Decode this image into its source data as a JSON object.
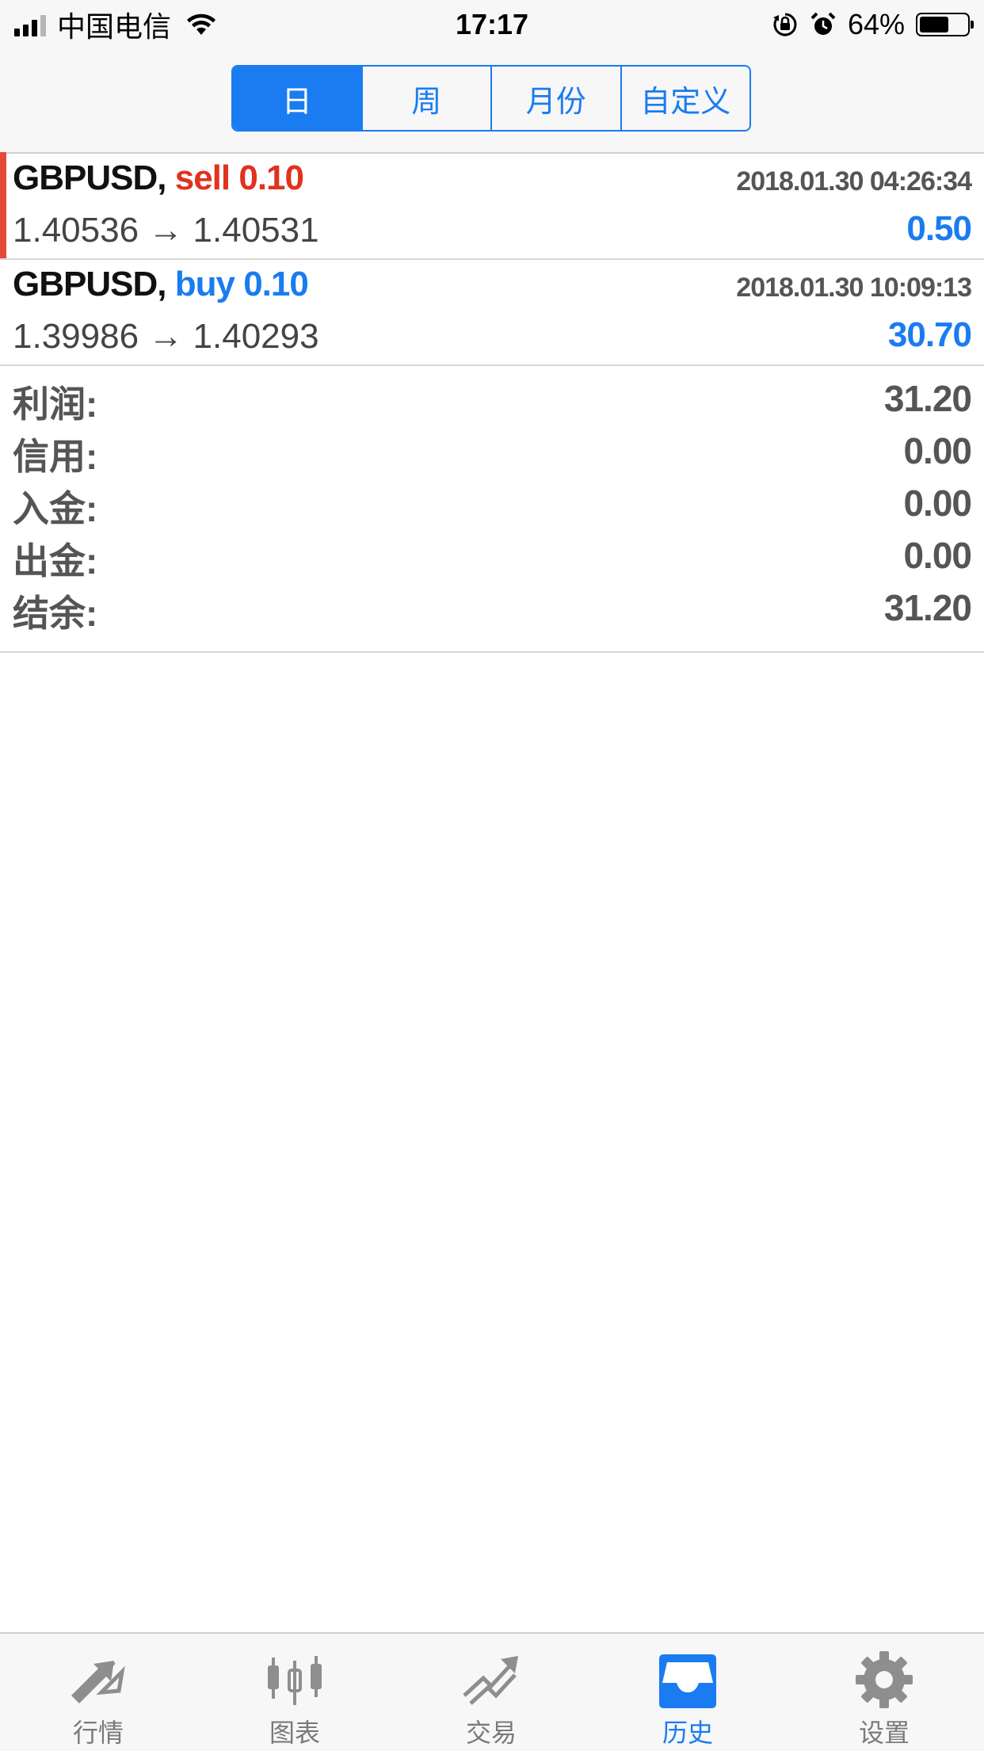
{
  "status_bar": {
    "carrier": "中国电信",
    "time": "17:17",
    "battery": "64%",
    "battery_level": 0.64
  },
  "period_tabs": [
    {
      "label": "日",
      "active": true
    },
    {
      "label": "周",
      "active": false
    },
    {
      "label": "月份",
      "active": false
    },
    {
      "label": "自定义",
      "active": false
    }
  ],
  "deals": [
    {
      "symbol": "GBPUSD,",
      "type": "sell",
      "volume": "0.10",
      "time": "2018.01.30 04:26:34",
      "open_price": "1.40536",
      "arrow": "→",
      "close_price": "1.40531",
      "profit": "0.50"
    },
    {
      "symbol": "GBPUSD,",
      "type": "buy",
      "volume": "0.10",
      "time": "2018.01.30 10:09:13",
      "open_price": "1.39986",
      "arrow": "→",
      "close_price": "1.40293",
      "profit": "30.70"
    }
  ],
  "summary": [
    {
      "label": "利润:",
      "value": "31.20"
    },
    {
      "label": "信用:",
      "value": "0.00"
    },
    {
      "label": "入金:",
      "value": "0.00"
    },
    {
      "label": "出金:",
      "value": "0.00"
    },
    {
      "label": "结余:",
      "value": "31.20"
    }
  ],
  "tab_bar": [
    {
      "label": "行情",
      "icon": "quotes-arrows-icon",
      "active": false
    },
    {
      "label": "图表",
      "icon": "candlestick-chart-icon",
      "active": false
    },
    {
      "label": "交易",
      "icon": "trade-trend-icon",
      "active": false
    },
    {
      "label": "历史",
      "icon": "history-inbox-icon",
      "active": true
    },
    {
      "label": "设置",
      "icon": "gear-icon",
      "active": false
    }
  ],
  "colors": {
    "accent": "#1a7cf0",
    "sell": "#e1321e",
    "sell_marker": "#e24a3c",
    "inactive": "#8e8e8e"
  }
}
